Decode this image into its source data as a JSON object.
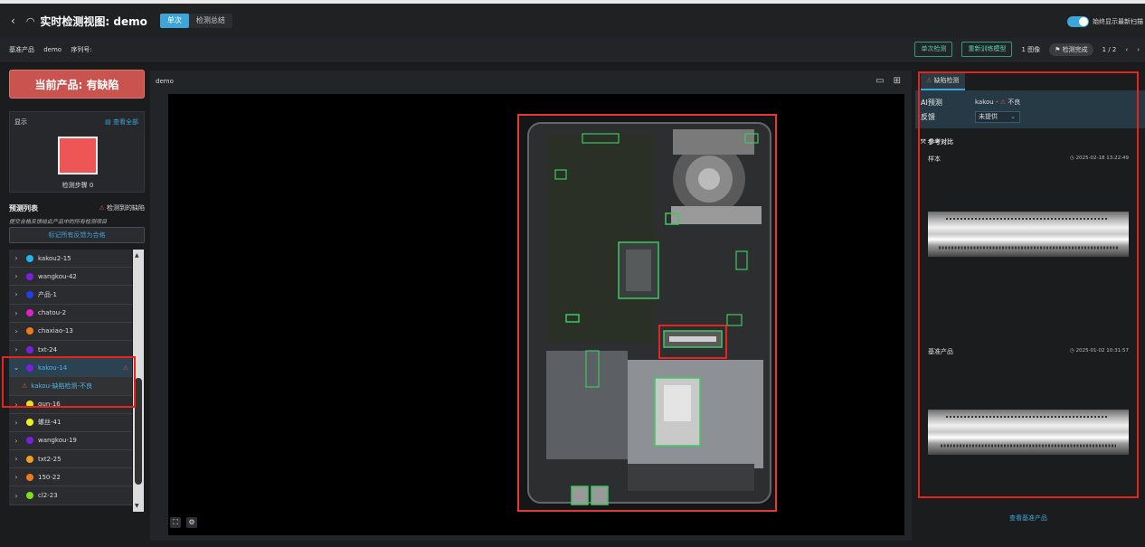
{
  "header": {
    "back_icon": "‹",
    "gauge_icon": "◠",
    "title": "实时检测视图: demo",
    "tabs": [
      {
        "label": "单次"
      },
      {
        "label": "检测总结"
      }
    ],
    "toggle_label": "始终显示最新扫描"
  },
  "subbar": {
    "base_product_label": "基准产品",
    "base_product_value": "demo",
    "serial_label": "序列号:",
    "single_detect": "单次检测",
    "retrain": "重新训练模型",
    "image_count": "1 图像",
    "status_chip": "⚑ 检测完成",
    "pager": "1 / 2",
    "prev": "‹",
    "next": "›"
  },
  "left": {
    "banner": "当前产品: 有缺陷",
    "display_label": "显示",
    "view_all": "▤ 查看全部",
    "step_label": "检测步骤 0",
    "pred_title": "预测列表",
    "pred_warn": "检测到的缺陷",
    "pred_hint": "提交合格反馈给此产品中的所有检测项目",
    "mark_all": "标记所有反馈为合格",
    "items": [
      {
        "label": "kakou2-15",
        "color": "#1fb7e8"
      },
      {
        "label": "wangkou-42",
        "color": "#7a1fe0"
      },
      {
        "label": "产品-1",
        "color": "#1f3fe8"
      },
      {
        "label": "chatou-2",
        "color": "#e020c8"
      },
      {
        "label": "chaxiao-13",
        "color": "#f07a1a"
      },
      {
        "label": "txt-24",
        "color": "#7a1fe0"
      },
      {
        "label": "kakou-14",
        "color": "#7a1fe0"
      },
      {
        "label": "kakou-缺陷检测-不良",
        "color": ""
      },
      {
        "label": "gun-16",
        "color": "#f0e01a"
      },
      {
        "label": "螺丝-41",
        "color": "#f0f01a"
      },
      {
        "label": "wangkou-19",
        "color": "#7a1fe0"
      },
      {
        "label": "txt2-25",
        "color": "#f0a01a"
      },
      {
        "label": "150-22",
        "color": "#f07a1a"
      },
      {
        "label": "cl2-23",
        "color": "#7ae01a"
      }
    ]
  },
  "center": {
    "title": "demo",
    "view_single_icon": "▭",
    "view_grid_icon": "⊞",
    "fit_icon": "⛶",
    "settings_icon": "⚙"
  },
  "right": {
    "tab": "缺陷检测",
    "ai_label": "AI预测",
    "ai_value_prefix": "kakou -",
    "ai_value_suffix": "不良",
    "feedback_label": "反馈",
    "feedback_value": "未提供",
    "ref_title": "参考对比",
    "sample_label": "样本",
    "sample_date": "2025-02-18 13:22:49",
    "base_label": "基准产品",
    "base_date": "2025-01-02 10:31:57",
    "view_base": "查看基准产品"
  },
  "colors": {
    "accent": "#3fa4d8",
    "defect": "#c9534e",
    "highlight": "#e8231c",
    "ok_green": "#2f9c7a"
  }
}
